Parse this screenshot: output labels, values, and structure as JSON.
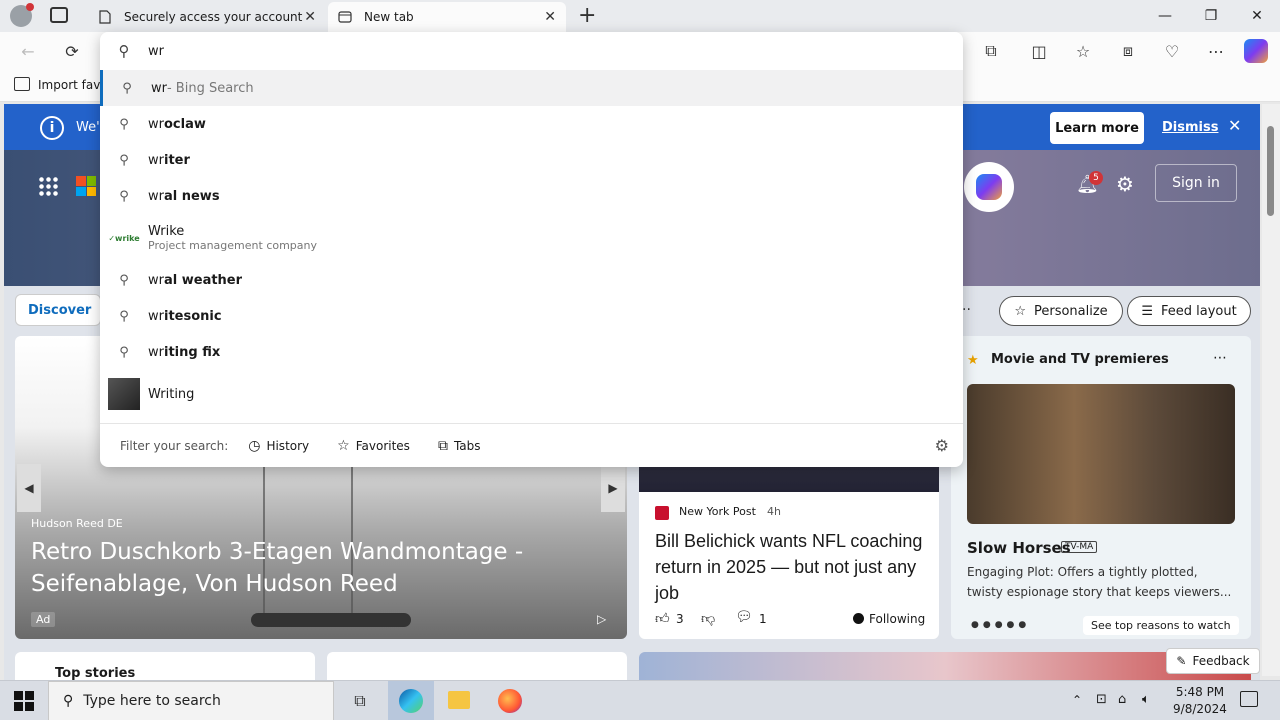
{
  "browser": {
    "tabs": [
      {
        "title": "Securely access your account"
      },
      {
        "title": "New tab"
      }
    ],
    "address_value": "wr",
    "favorites_bar_label": "Import favo"
  },
  "suggestions": {
    "items": [
      {
        "bold": "wr",
        "rest": "",
        "suffix": " - Bing Search"
      },
      {
        "bold": "wr",
        "rest": "oclaw"
      },
      {
        "bold": "wr",
        "rest": "iter"
      },
      {
        "bold": "wr",
        "rest": "al news"
      },
      {
        "title": "Wrike",
        "subtitle": "Project management company",
        "logo": "wrike"
      },
      {
        "bold": "wr",
        "rest": "al weather"
      },
      {
        "bold": "wr",
        "rest": "itesonic"
      },
      {
        "bold": "wr",
        "rest": "iting fix"
      },
      {
        "title": "Writing"
      }
    ],
    "filter_label": "Filter your search:",
    "filters": [
      "History",
      "Favorites",
      "Tabs"
    ]
  },
  "banner": {
    "text_fragment": "We'",
    "learn_more": "Learn more",
    "dismiss": "Dismiss"
  },
  "header": {
    "notification_count": "5",
    "sign_in": "Sign in"
  },
  "feed": {
    "discover_tab": "Discover",
    "personalize": "Personalize",
    "feed_layout": "Feed layout",
    "ad_card": {
      "source": "Hudson Reed DE",
      "title": "Retro Duschkorb 3-Etagen Wandmontage - Seifenablage, Von Hudson Reed",
      "ad_label": "Ad"
    },
    "news_card": {
      "source": "New York Post",
      "age": "4h",
      "title": "Bill Belichick wants NFL coaching return in 2025 — but not just any job",
      "likes": "3",
      "comments": "1",
      "following": "Following"
    },
    "movie_card": {
      "header": "Movie and TV premieres",
      "title": "Slow Horses",
      "rating": "TV-MA",
      "description": "Engaging Plot: Offers a tightly plotted, twisty espionage story that keeps viewers...",
      "cta": "See top reasons to watch"
    },
    "top_stories": "Top stories",
    "feedback": "Feedback"
  },
  "taskbar": {
    "search_placeholder": "Type here to search",
    "time": "5:48 PM",
    "date": "9/8/2024"
  },
  "colors": {
    "accent": "#0f6cbd",
    "banner": "#2362ca"
  }
}
